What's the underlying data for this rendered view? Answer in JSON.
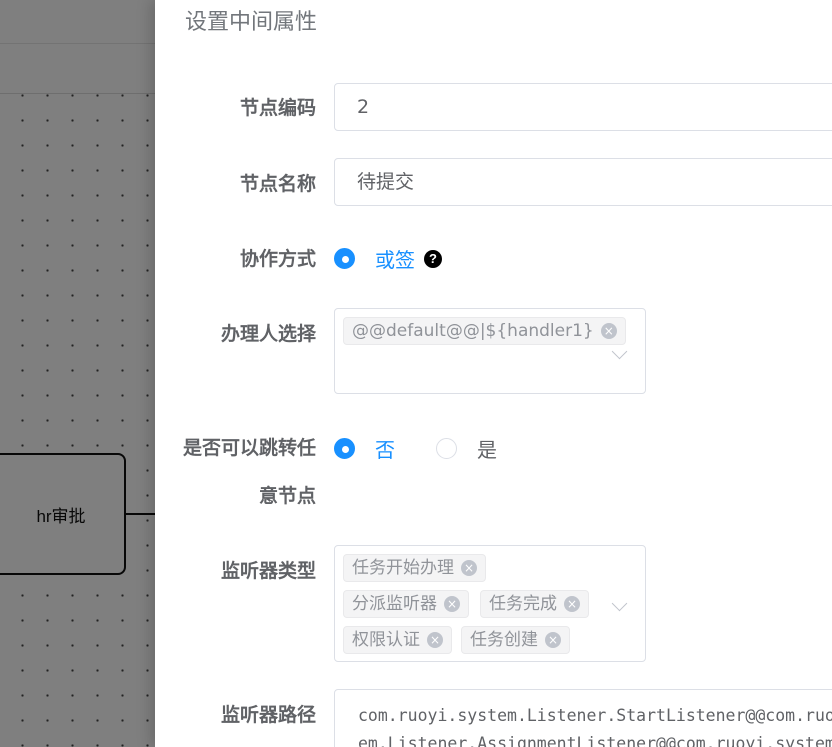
{
  "canvas": {
    "node_label": "hr审批"
  },
  "drawer": {
    "title": "设置中间属性",
    "node_code": {
      "label": "节点编码",
      "value": "2"
    },
    "node_name": {
      "label": "节点名称",
      "value": "待提交"
    },
    "cooperation": {
      "label": "协作方式",
      "option": "或签",
      "help_icon": "question-circle-icon"
    },
    "handler": {
      "label": "办理人选择",
      "tags": [
        "@@default@@|${handler1}"
      ]
    },
    "jump": {
      "label_line1": "是否可以跳转任",
      "label_line2": "意节点",
      "options": [
        "否",
        "是"
      ],
      "selected": "否"
    },
    "listener_type": {
      "label": "监听器类型",
      "tags": [
        "任务开始办理",
        "分派监听器",
        "任务完成",
        "权限认证",
        "任务创建"
      ]
    },
    "listener_path": {
      "label": "监听器路径",
      "line1": "com.ruoyi.system.Listener.StartListener@@com.ruoy",
      "line2": "em.Listener.AssignmentListener@@com.ruoyi.system."
    }
  },
  "colors": {
    "primary": "#1890ff",
    "label": "#606266",
    "tag_bg": "#f4f4f5"
  }
}
